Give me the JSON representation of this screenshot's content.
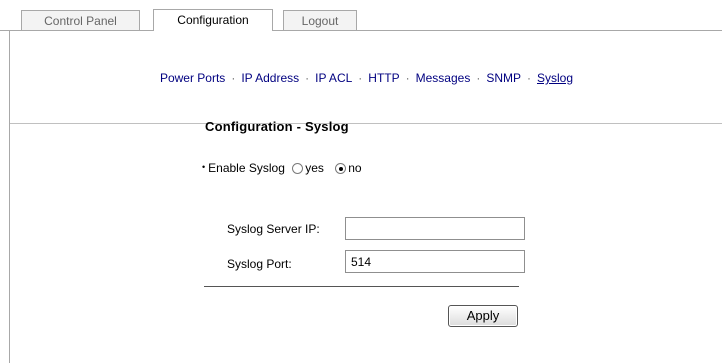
{
  "tabs": [
    {
      "label": "Control Panel",
      "active": false
    },
    {
      "label": "Configuration",
      "active": true
    },
    {
      "label": "Logout",
      "active": false
    }
  ],
  "subnav": {
    "items": [
      "Power Ports",
      "IP Address",
      "IP ACL",
      "HTTP",
      "Messages",
      "SNMP",
      "Syslog"
    ],
    "separator": "·",
    "current": "Syslog"
  },
  "page": {
    "title": "Configuration - Syslog"
  },
  "form": {
    "bullet": "•",
    "enable_label": "Enable Syslog",
    "option_yes": "yes",
    "option_no": "no",
    "selected": "no",
    "server_ip_label": "Syslog Server IP:",
    "server_ip_value": "",
    "port_label": "Syslog Port:",
    "port_value": "514",
    "apply_label": "Apply"
  },
  "colors": {
    "link": "#000080",
    "border": "#a8a8a8",
    "inactive_tab_text": "#666666"
  }
}
